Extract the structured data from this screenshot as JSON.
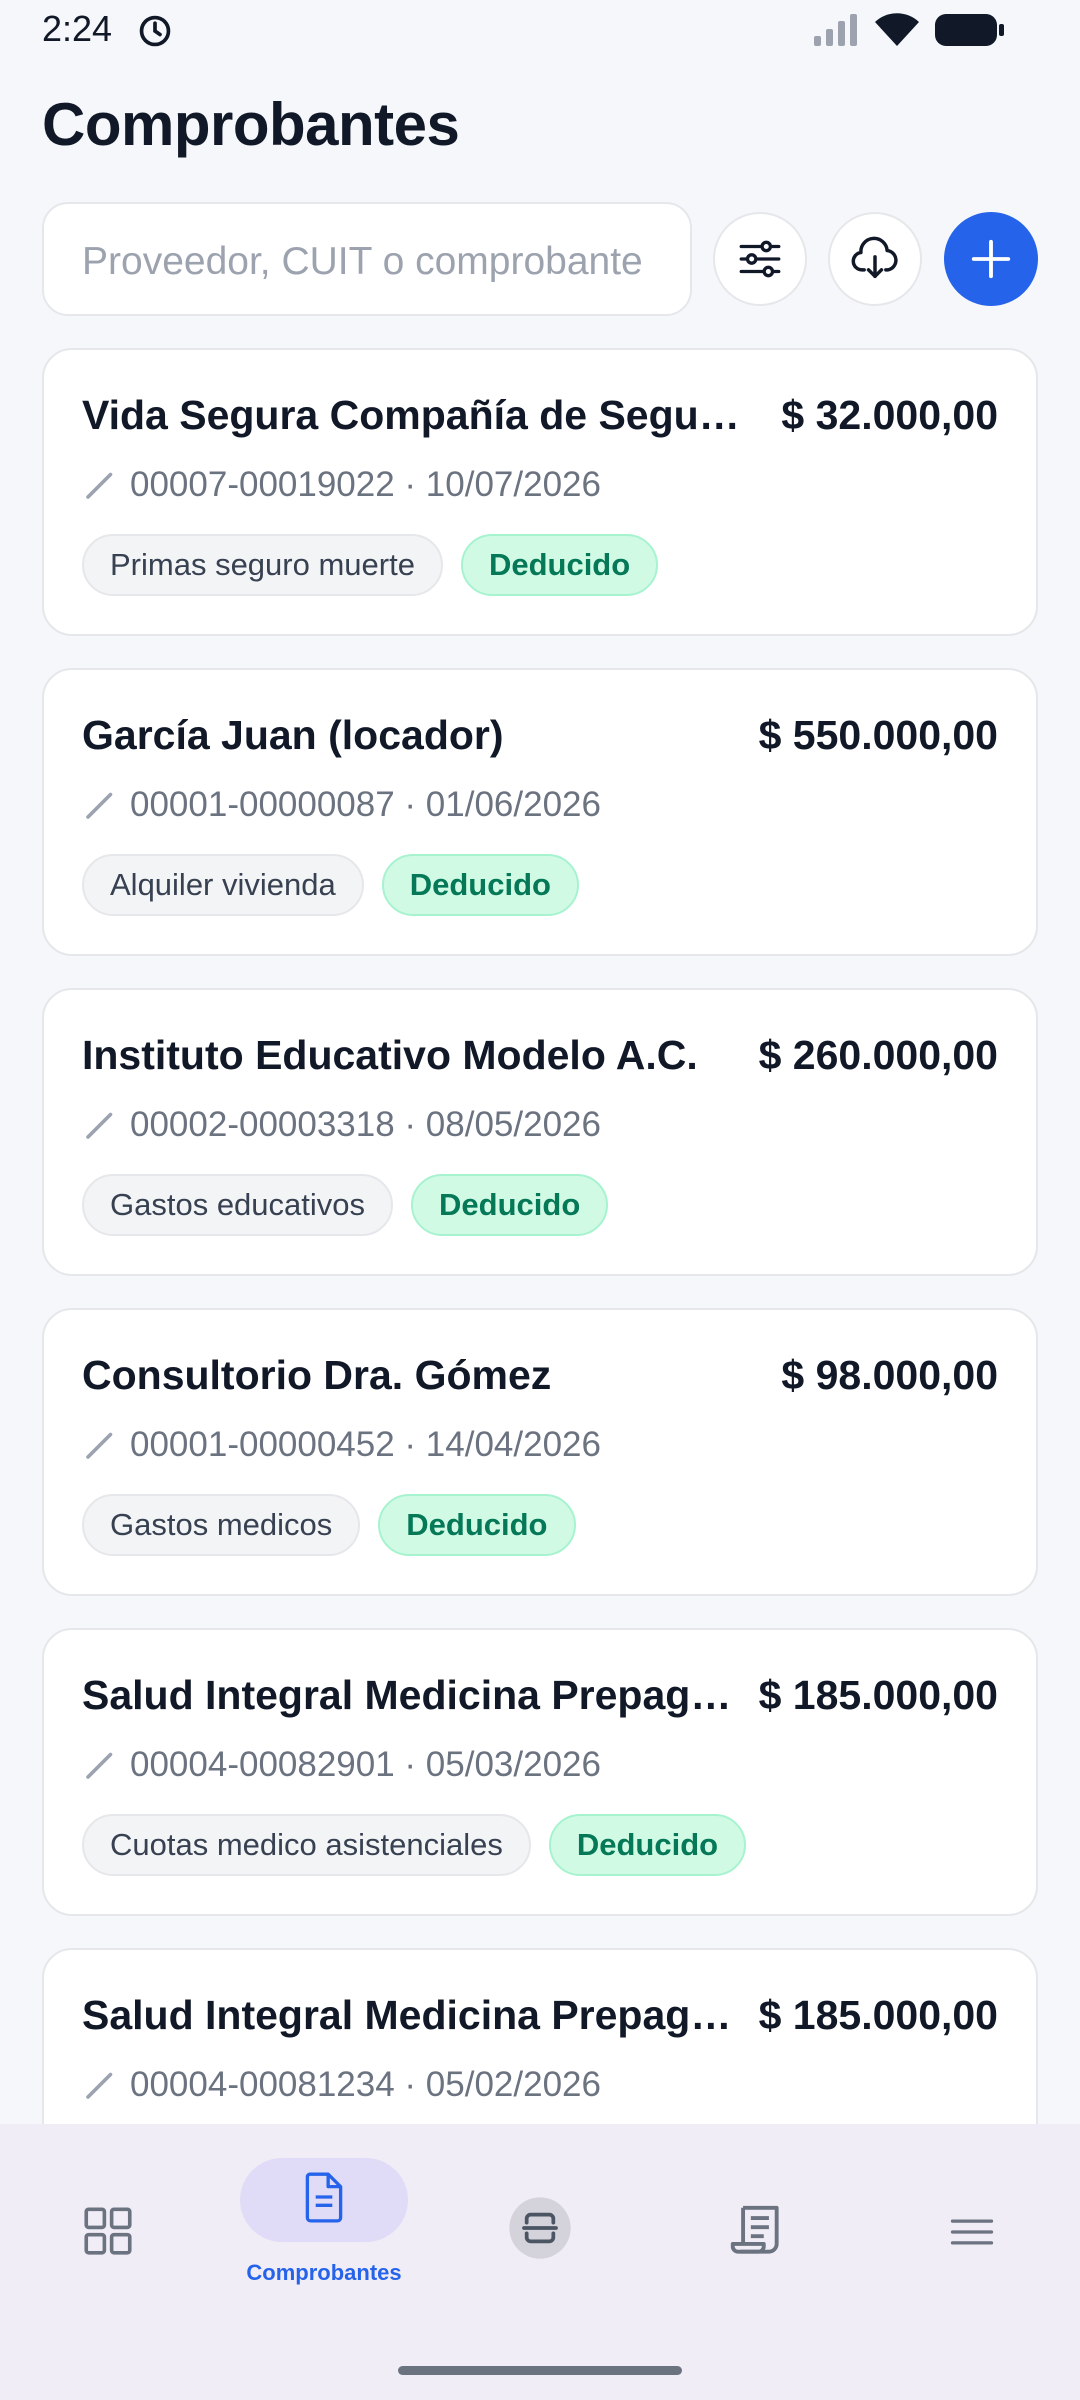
{
  "status_bar": {
    "time": "2:24",
    "icons": [
      "clock-icon",
      "signal-icon",
      "wifi-icon",
      "battery-icon"
    ]
  },
  "header": {
    "title": "Comprobantes"
  },
  "search": {
    "placeholder": "Proveedor, CUIT o comprobante"
  },
  "actions": {
    "filter_icon": "sliders-icon",
    "cloud_icon": "cloud-download-icon",
    "add_icon": "plus-icon",
    "add_color": "#2563eb"
  },
  "receipts": [
    {
      "provider": "Vida Segura Compañía de Seguros S.A.",
      "amount": "$ 32.000,00",
      "meta": "00007-00019022 · 10/07/2026",
      "category": "Primas seguro muerte",
      "status": "Deducido"
    },
    {
      "provider": "García Juan (locador)",
      "amount": "$ 550.000,00",
      "meta": "00001-00000087 · 01/06/2026",
      "category": "Alquiler vivienda",
      "status": "Deducido"
    },
    {
      "provider": "Instituto Educativo Modelo A.C.",
      "amount": "$ 260.000,00",
      "meta": "00002-00003318 · 08/05/2026",
      "category": "Gastos educativos",
      "status": "Deducido"
    },
    {
      "provider": "Consultorio Dra. Gómez",
      "amount": "$ 98.000,00",
      "meta": "00001-00000452 · 14/04/2026",
      "category": "Gastos medicos",
      "status": "Deducido"
    },
    {
      "provider": "Salud Integral Medicina Prepaga S.A.",
      "amount": "$ 185.000,00",
      "meta": "00004-00082901 · 05/03/2026",
      "category": "Cuotas medico asistenciales",
      "status": "Deducido"
    },
    {
      "provider": "Salud Integral Medicina Prepaga S.A.",
      "amount": "$ 185.000,00",
      "meta": "00004-00081234 · 05/02/2026",
      "category": "",
      "status": ""
    }
  ],
  "bottom_nav": {
    "items": [
      {
        "icon": "dashboard-grid-icon",
        "label": ""
      },
      {
        "icon": "document-icon",
        "label": "Comprobantes",
        "active": true
      },
      {
        "icon": "scan-icon",
        "label": ""
      },
      {
        "icon": "receipt-icon",
        "label": ""
      },
      {
        "icon": "menu-icon",
        "label": ""
      }
    ]
  },
  "colors": {
    "accent": "#2563eb",
    "status_bg": "#d1fae5",
    "status_text": "#047857",
    "nav_bg": "#f1edf6"
  }
}
